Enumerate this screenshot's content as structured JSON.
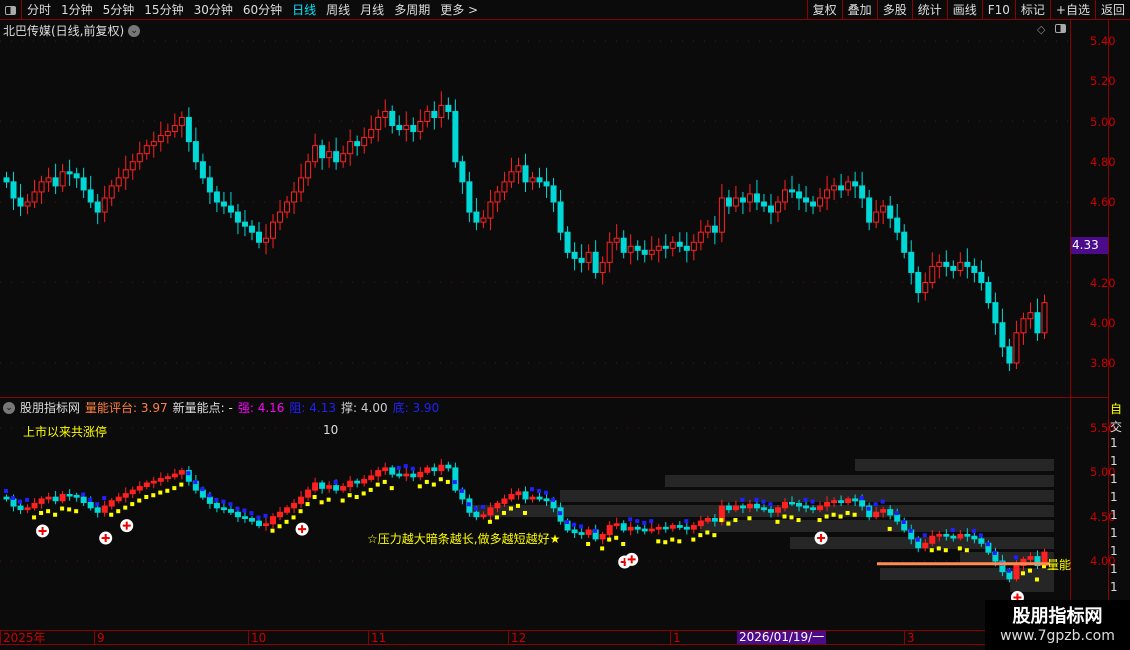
{
  "toolbar": {
    "periods": [
      "分时",
      "1分钟",
      "5分钟",
      "15分钟",
      "30分钟",
      "60分钟",
      "日线",
      "周线",
      "月线",
      "多周期",
      "更多 >"
    ],
    "active": "日线",
    "right_buttons": [
      "复权",
      "叠加",
      "多股",
      "统计",
      "画线",
      "F10",
      "标记",
      "+自选",
      "返回"
    ]
  },
  "main": {
    "title": "北巴传媒(日线,前复权)",
    "price_labels": [
      "5.40",
      "5.20",
      "5.00",
      "4.80",
      "4.60",
      "4.20",
      "4.00",
      "3.80"
    ],
    "current_price": "4.33"
  },
  "indicator": {
    "name": "股朋指标网",
    "score_label": "量能评台:",
    "score": "3.97",
    "new_label": "新量能点:",
    "new_value": "-",
    "strong_label": "强:",
    "strong": "4.16",
    "resist_label": "阻:",
    "resist": "4.13",
    "support_label": "撑:",
    "support": "4.00",
    "bottom_label": "底:",
    "bottom": "3.90",
    "limit_label": "上市以来共涨停",
    "limit_count": "10",
    "slogan": "☆压力越大暗条越长,做多越短越好★",
    "line_label": "量能",
    "price_labels": [
      "5.50",
      "5.00",
      "4.50",
      "4.00"
    ],
    "right_col": [
      "自",
      "交",
      "1",
      "1",
      "1",
      "1",
      "1",
      "1",
      "1",
      "1",
      "1",
      "1",
      "1"
    ]
  },
  "timeaxis": {
    "labels": [
      "2025年",
      "9",
      "10",
      "11",
      "12",
      "1",
      "3"
    ],
    "selected": "2026/01/19/一"
  },
  "watermark": {
    "title": "股朋指标网",
    "url": "www.7gpzb.com"
  },
  "colors": {
    "up": "#ff2020",
    "down": "#00d8d8",
    "border": "#8b0000",
    "yellow": "#ffff00",
    "blue": "#2020ff"
  },
  "chart_data": {
    "type": "candlestick",
    "closes": [
      4.7,
      4.62,
      4.58,
      4.6,
      4.65,
      4.7,
      4.72,
      4.68,
      4.75,
      4.74,
      4.72,
      4.66,
      4.6,
      4.55,
      4.62,
      4.68,
      4.72,
      4.76,
      4.8,
      4.84,
      4.88,
      4.9,
      4.93,
      4.95,
      4.98,
      5.02,
      4.9,
      4.8,
      4.72,
      4.65,
      4.6,
      4.58,
      4.55,
      4.5,
      4.48,
      4.45,
      4.4,
      4.42,
      4.5,
      4.55,
      4.6,
      4.65,
      4.72,
      4.8,
      4.88,
      4.82,
      4.85,
      4.8,
      4.84,
      4.9,
      4.88,
      4.92,
      4.96,
      5.02,
      5.05,
      4.98,
      4.96,
      4.98,
      4.95,
      5.0,
      5.05,
      5.02,
      5.08,
      5.05,
      4.8,
      4.7,
      4.55,
      4.5,
      4.52,
      4.6,
      4.65,
      4.7,
      4.75,
      4.78,
      4.7,
      4.72,
      4.7,
      4.68,
      4.6,
      4.45,
      4.35,
      4.32,
      4.3,
      4.35,
      4.25,
      4.3,
      4.4,
      4.42,
      4.35,
      4.38,
      4.36,
      4.34,
      4.36,
      4.38,
      4.37,
      4.4,
      4.38,
      4.36,
      4.4,
      4.45,
      4.48,
      4.45,
      4.62,
      4.58,
      4.62,
      4.6,
      4.64,
      4.6,
      4.58,
      4.55,
      4.6,
      4.66,
      4.65,
      4.62,
      4.6,
      4.58,
      4.62,
      4.66,
      4.68,
      4.66,
      4.7,
      4.68,
      4.62,
      4.5,
      4.55,
      4.58,
      4.52,
      4.45,
      4.35,
      4.25,
      4.15,
      4.2,
      4.28,
      4.3,
      4.28,
      4.26,
      4.3,
      4.28,
      4.25,
      4.2,
      4.1,
      4.0,
      3.88,
      3.8,
      3.95,
      4.02,
      4.05,
      3.95,
      4.1
    ],
    "ylim_main": [
      3.72,
      5.45
    ],
    "ylim_indicator": [
      3.7,
      5.8
    ],
    "signal_indices": [
      5,
      14,
      17,
      42,
      88,
      89,
      116,
      144
    ],
    "pressure_level": 3.97
  }
}
